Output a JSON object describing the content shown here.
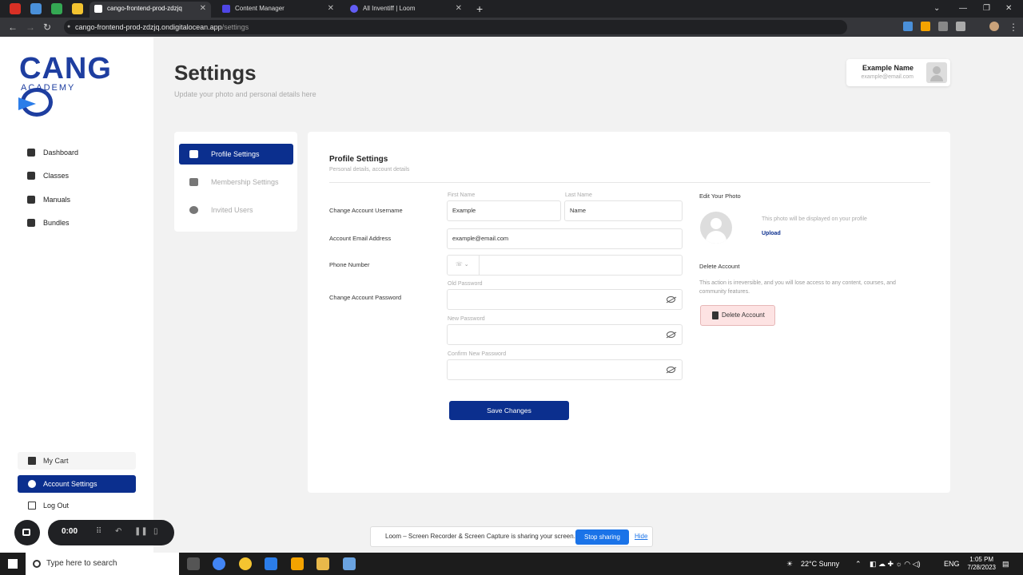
{
  "browser": {
    "tabs": [
      {
        "title": "cango-frontend-prod-zdzjq",
        "active": true
      },
      {
        "title": "Content Manager",
        "active": false
      },
      {
        "title": "All Inventiff | Loom",
        "active": false
      }
    ],
    "url_host": "cango-frontend-prod-zdzjq.ondigitalocean.app",
    "url_path": "/settings"
  },
  "logo": {
    "main": "CANG",
    "sub": "ACADEMY"
  },
  "sidebar": {
    "items": [
      {
        "label": "Dashboard"
      },
      {
        "label": "Classes"
      },
      {
        "label": "Manuals"
      },
      {
        "label": "Bundles"
      }
    ],
    "cart": "My Cart",
    "account": "Account Settings",
    "logout": "Log Out"
  },
  "header": {
    "title": "Settings",
    "subtitle": "Update your photo and personal details here"
  },
  "user": {
    "name": "Example Name",
    "email": "example@email.com"
  },
  "settings_menu": [
    {
      "label": "Profile Settings"
    },
    {
      "label": "Membership Settings"
    },
    {
      "label": "Invited Users"
    }
  ],
  "profile": {
    "title": "Profile Settings",
    "subtitle": "Personal details, account details",
    "username_label": "Change Account Username",
    "first_name_label": "First Name",
    "first_name": "Example",
    "last_name_label": "Last Name",
    "last_name": "Name",
    "email_label": "Account Email Address",
    "email": "example@email.com",
    "phone_label": "Phone Number",
    "password_label": "Change Account Password",
    "old_password_label": "Old Password",
    "new_password_label": "New Password",
    "confirm_password_label": "Confirm New Password",
    "save": "Save Changes"
  },
  "photo": {
    "title": "Edit Your Photo",
    "hint": "This photo will be displayed on your profile",
    "upload": "Upload"
  },
  "delete": {
    "title": "Delete Account",
    "description": "This action is irreversible, and you will lose access to any content, courses, and community features.",
    "button": "Delete Account"
  },
  "loom": {
    "time": "0:00",
    "share_text": "Loom – Screen Recorder & Screen Capture is sharing your screen.",
    "stop": "Stop sharing",
    "hide": "Hide"
  },
  "taskbar": {
    "search_placeholder": "Type here to search",
    "weather": "22°C  Sunny",
    "lang": "ENG",
    "time": "1:05 PM",
    "date": "7/28/2023"
  }
}
